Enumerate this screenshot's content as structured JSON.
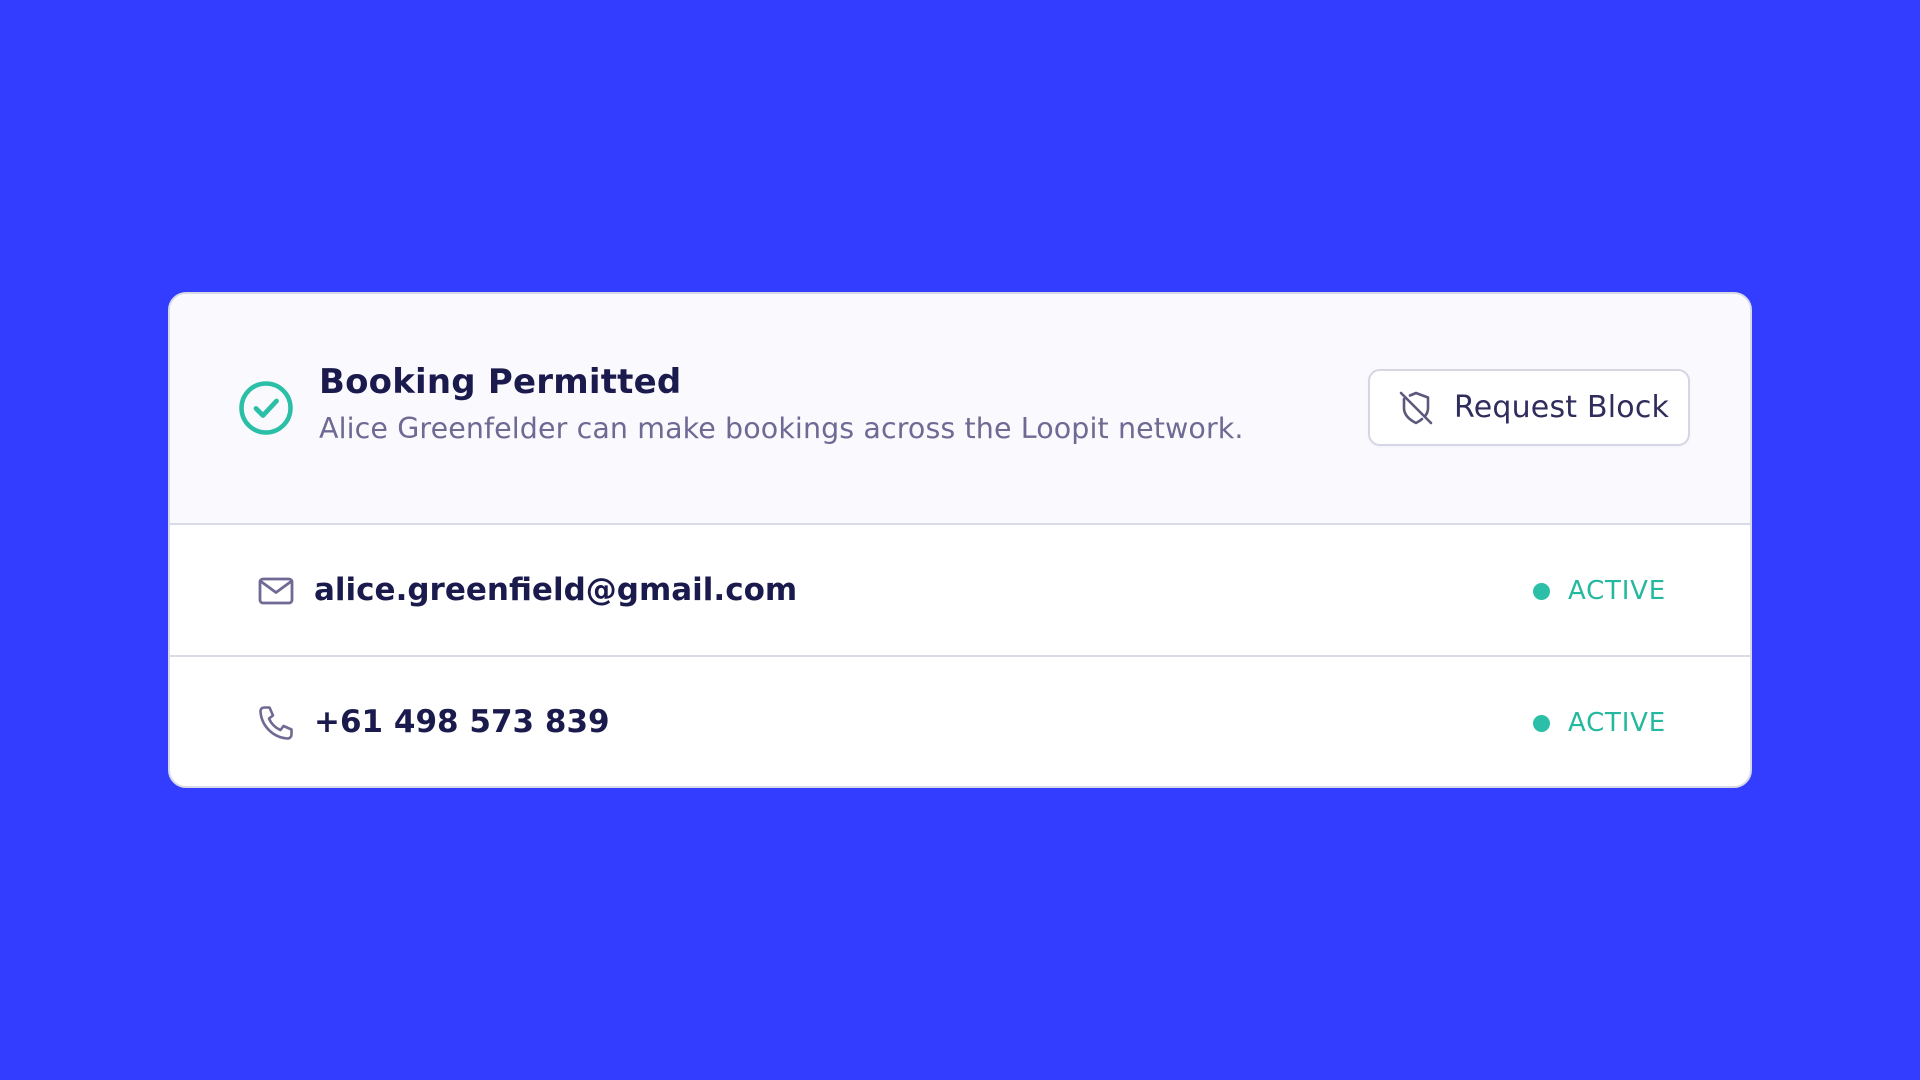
{
  "colors": {
    "background": "#323dff",
    "accent_success": "#2abfa6",
    "text_primary": "#1b1a4d",
    "text_secondary": "#6e6a93"
  },
  "card": {
    "header": {
      "status_icon": "check-circle-icon",
      "title": "Booking Permitted",
      "subtitle": "Alice Greenfelder can make bookings across the Loopit network.",
      "action": {
        "icon": "shield-off-icon",
        "label": "Request Block"
      }
    },
    "contacts": [
      {
        "type": "email",
        "icon": "mail-icon",
        "value": "alice.greenfield@gmail.com",
        "status": "ACTIVE"
      },
      {
        "type": "phone",
        "icon": "phone-icon",
        "value": "+61 498 573 839",
        "status": "ACTIVE"
      }
    ]
  }
}
